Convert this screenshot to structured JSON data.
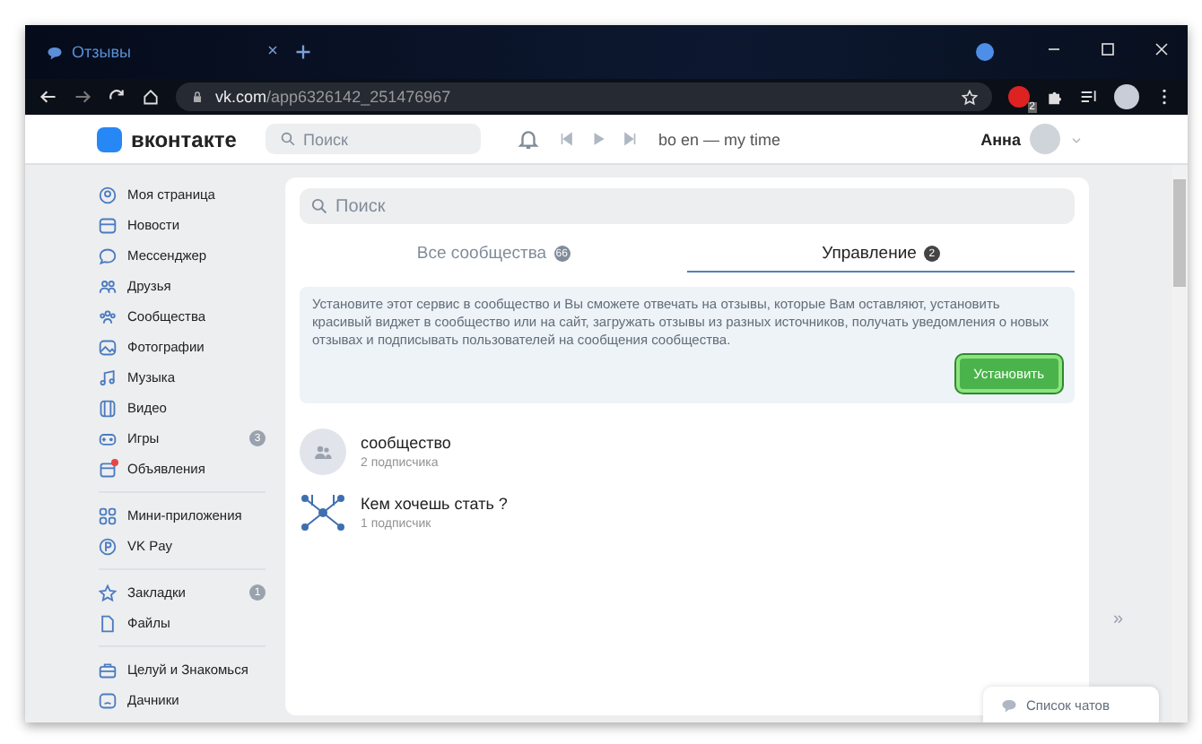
{
  "browser": {
    "tab_title": "Отзывы",
    "url_domain": "vk.com",
    "url_path": "/app6326142_251476967",
    "extension_badge": "2"
  },
  "header": {
    "logo_text": "вконтакте",
    "search_placeholder": "Поиск",
    "track": "bo en — my time",
    "user_name": "Анна"
  },
  "sidebar": {
    "groups": [
      [
        {
          "label": "Моя страница",
          "dot": false
        },
        {
          "label": "Новости",
          "dot": false
        },
        {
          "label": "Мессенджер",
          "dot": false
        },
        {
          "label": "Друзья",
          "dot": false
        },
        {
          "label": "Сообщества",
          "dot": false
        },
        {
          "label": "Фотографии",
          "dot": false
        },
        {
          "label": "Музыка",
          "dot": false
        },
        {
          "label": "Видео",
          "dot": false
        },
        {
          "label": "Игры",
          "badge": "3",
          "dot": false
        },
        {
          "label": "Объявления",
          "dot": true
        }
      ],
      [
        {
          "label": "Мини-приложения",
          "dot": false
        },
        {
          "label": "VK Pay",
          "dot": false
        }
      ],
      [
        {
          "label": "Закладки",
          "badge": "1",
          "dot": false
        },
        {
          "label": "Файлы",
          "dot": false
        }
      ],
      [
        {
          "label": "Целуй и Знакомься",
          "dot": false
        },
        {
          "label": "Дачники",
          "dot": false
        }
      ]
    ]
  },
  "main": {
    "search_placeholder": "Поиск",
    "tabs": [
      {
        "label": "Все сообщества",
        "count": "66",
        "selected": false
      },
      {
        "label": "Управление",
        "count": "2",
        "selected": true
      }
    ],
    "info": {
      "text": "Установите этот сервис в сообщество и Вы сможете отвечать на отзывы, которые Вам оставляют, установить красивый виджет в сообщество или на сайт, загружать отзывы из разных источников, получать уведомления о новых отзывах и подписывать пользователей на сообщения сообщества.",
      "button": "Установить"
    },
    "communities": [
      {
        "name": "сообщество",
        "subscribers": "2 подписчика",
        "kind": "placeholder"
      },
      {
        "name": "Кем хочешь стать ?",
        "subscribers": "1 подписчик",
        "kind": "drawing"
      }
    ]
  },
  "collapse": "»",
  "chat_list": "Список чатов"
}
